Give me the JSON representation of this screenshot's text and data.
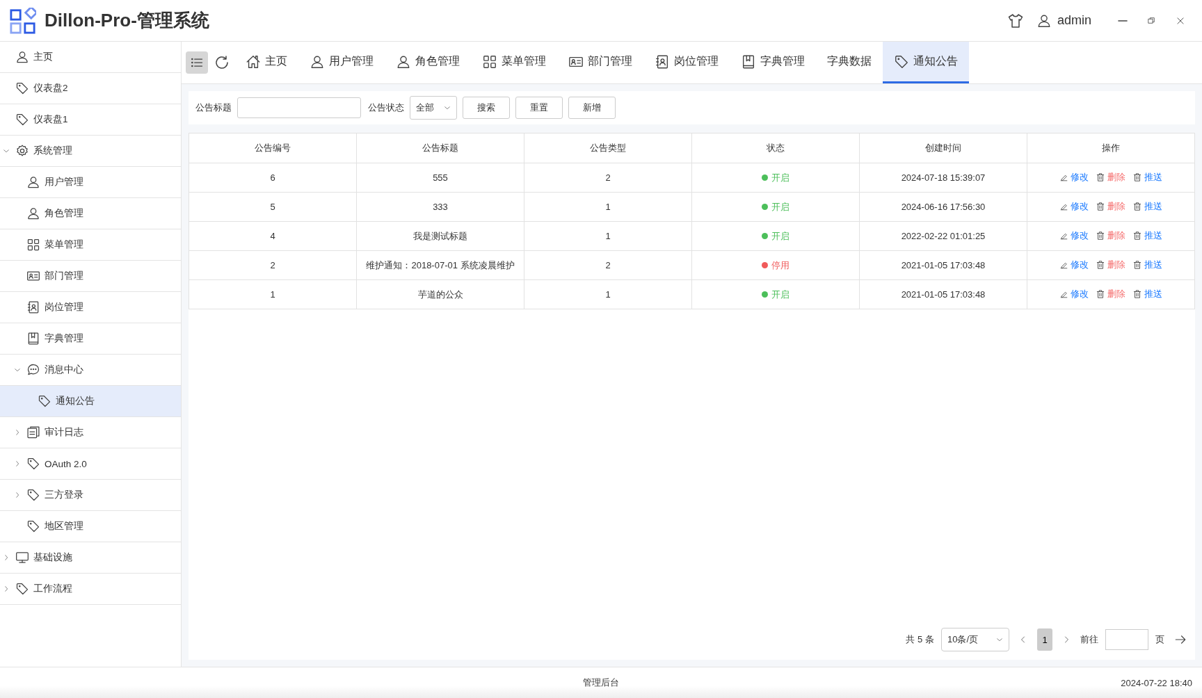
{
  "header": {
    "title": "Dillon-Pro-管理系统",
    "user": "admin"
  },
  "sidebar": {
    "items": [
      {
        "label": "主页",
        "kind": "user",
        "selected": false
      },
      {
        "label": "仪表盘2",
        "kind": "tag",
        "selected": false
      },
      {
        "label": "仪表盘1",
        "kind": "tag",
        "selected": false
      },
      {
        "label": "系统管理",
        "kind": "gear",
        "selected": false,
        "expanded": true,
        "children": [
          {
            "label": "用户管理",
            "kind": "user",
            "selected": false
          },
          {
            "label": "角色管理",
            "kind": "user",
            "selected": false
          },
          {
            "label": "菜单管理",
            "kind": "grid",
            "selected": false
          },
          {
            "label": "部门管理",
            "kind": "idcard",
            "selected": false
          },
          {
            "label": "岗位管理",
            "kind": "contact",
            "selected": false
          },
          {
            "label": "字典管理",
            "kind": "book",
            "selected": false
          },
          {
            "label": "消息中心",
            "kind": "chat",
            "selected": false,
            "expanded": true,
            "children": [
              {
                "label": "通知公告",
                "kind": "tag",
                "selected": true
              }
            ]
          },
          {
            "label": "审计日志",
            "kind": "doc",
            "selected": false,
            "expanded": false
          },
          {
            "label": "OAuth 2.0",
            "kind": "tag",
            "selected": false,
            "expanded": false
          },
          {
            "label": "三方登录",
            "kind": "tag",
            "selected": false,
            "expanded": false
          },
          {
            "label": "地区管理",
            "kind": "tag",
            "selected": false
          }
        ]
      },
      {
        "label": "基础设施",
        "kind": "monitor",
        "selected": false,
        "expanded": false
      },
      {
        "label": "工作流程",
        "kind": "tag",
        "selected": false,
        "expanded": false
      }
    ]
  },
  "tabs": [
    {
      "label": "主页",
      "kind": "home",
      "selected": false
    },
    {
      "label": "用户管理",
      "kind": "user",
      "selected": false
    },
    {
      "label": "角色管理",
      "kind": "user",
      "selected": false
    },
    {
      "label": "菜单管理",
      "kind": "grid",
      "selected": false
    },
    {
      "label": "部门管理",
      "kind": "idcard",
      "selected": false
    },
    {
      "label": "岗位管理",
      "kind": "contact",
      "selected": false
    },
    {
      "label": "字典管理",
      "kind": "book",
      "selected": false
    },
    {
      "label": "字典数据",
      "kind": "text",
      "selected": false
    },
    {
      "label": "通知公告",
      "kind": "tag",
      "selected": true
    }
  ],
  "search": {
    "title_label": "公告标题",
    "status_label": "公告状态",
    "status_value": "全部",
    "buttons": [
      "搜索",
      "重置",
      "新增"
    ]
  },
  "table": {
    "columns": [
      "公告编号",
      "公告标题",
      "公告类型",
      "状态",
      "创建时间",
      "操作"
    ],
    "rows": [
      {
        "id": "6",
        "title": "555",
        "type": "2",
        "status": "开启",
        "active": true,
        "created": "2024-07-18 15:39:07",
        "actions": [
          {
            "kind": "edit",
            "label": "修改"
          },
          {
            "kind": "delete",
            "label": "删除"
          },
          {
            "kind": "push",
            "label": "推送"
          }
        ]
      },
      {
        "id": "5",
        "title": "333",
        "type": "1",
        "status": "开启",
        "active": true,
        "created": "2024-06-16 17:56:30",
        "actions": [
          {
            "kind": "edit",
            "label": "修改"
          },
          {
            "kind": "delete",
            "label": "删除"
          },
          {
            "kind": "push",
            "label": "推送"
          }
        ]
      },
      {
        "id": "4",
        "title": "我是测试标题",
        "type": "1",
        "status": "开启",
        "active": true,
        "created": "2022-02-22 01:01:25",
        "actions": [
          {
            "kind": "edit",
            "label": "修改"
          },
          {
            "kind": "delete",
            "label": "删除"
          },
          {
            "kind": "push",
            "label": "推送"
          }
        ]
      },
      {
        "id": "2",
        "title": "维护通知：2018-07-01 系统凌晨维护",
        "type": "2",
        "status": "停用",
        "active": false,
        "created": "2021-01-05 17:03:48",
        "actions": [
          {
            "kind": "edit",
            "label": "修改"
          },
          {
            "kind": "delete",
            "label": "删除"
          },
          {
            "kind": "push",
            "label": "推送"
          }
        ]
      },
      {
        "id": "1",
        "title": "芋道的公众",
        "type": "1",
        "status": "开启",
        "active": true,
        "created": "2021-01-05 17:03:48",
        "actions": [
          {
            "kind": "edit",
            "label": "修改"
          },
          {
            "kind": "delete",
            "label": "删除"
          },
          {
            "kind": "push",
            "label": "推送"
          }
        ]
      }
    ]
  },
  "pagination": {
    "total": "共 5 条",
    "page_size": "10条/页",
    "pages": [
      {
        "label": "1",
        "selected": true
      }
    ],
    "goto_label": "前往",
    "page_unit": "页"
  },
  "status_bar": {
    "center": "管理后台",
    "time": "2024-07-22 18:40"
  }
}
